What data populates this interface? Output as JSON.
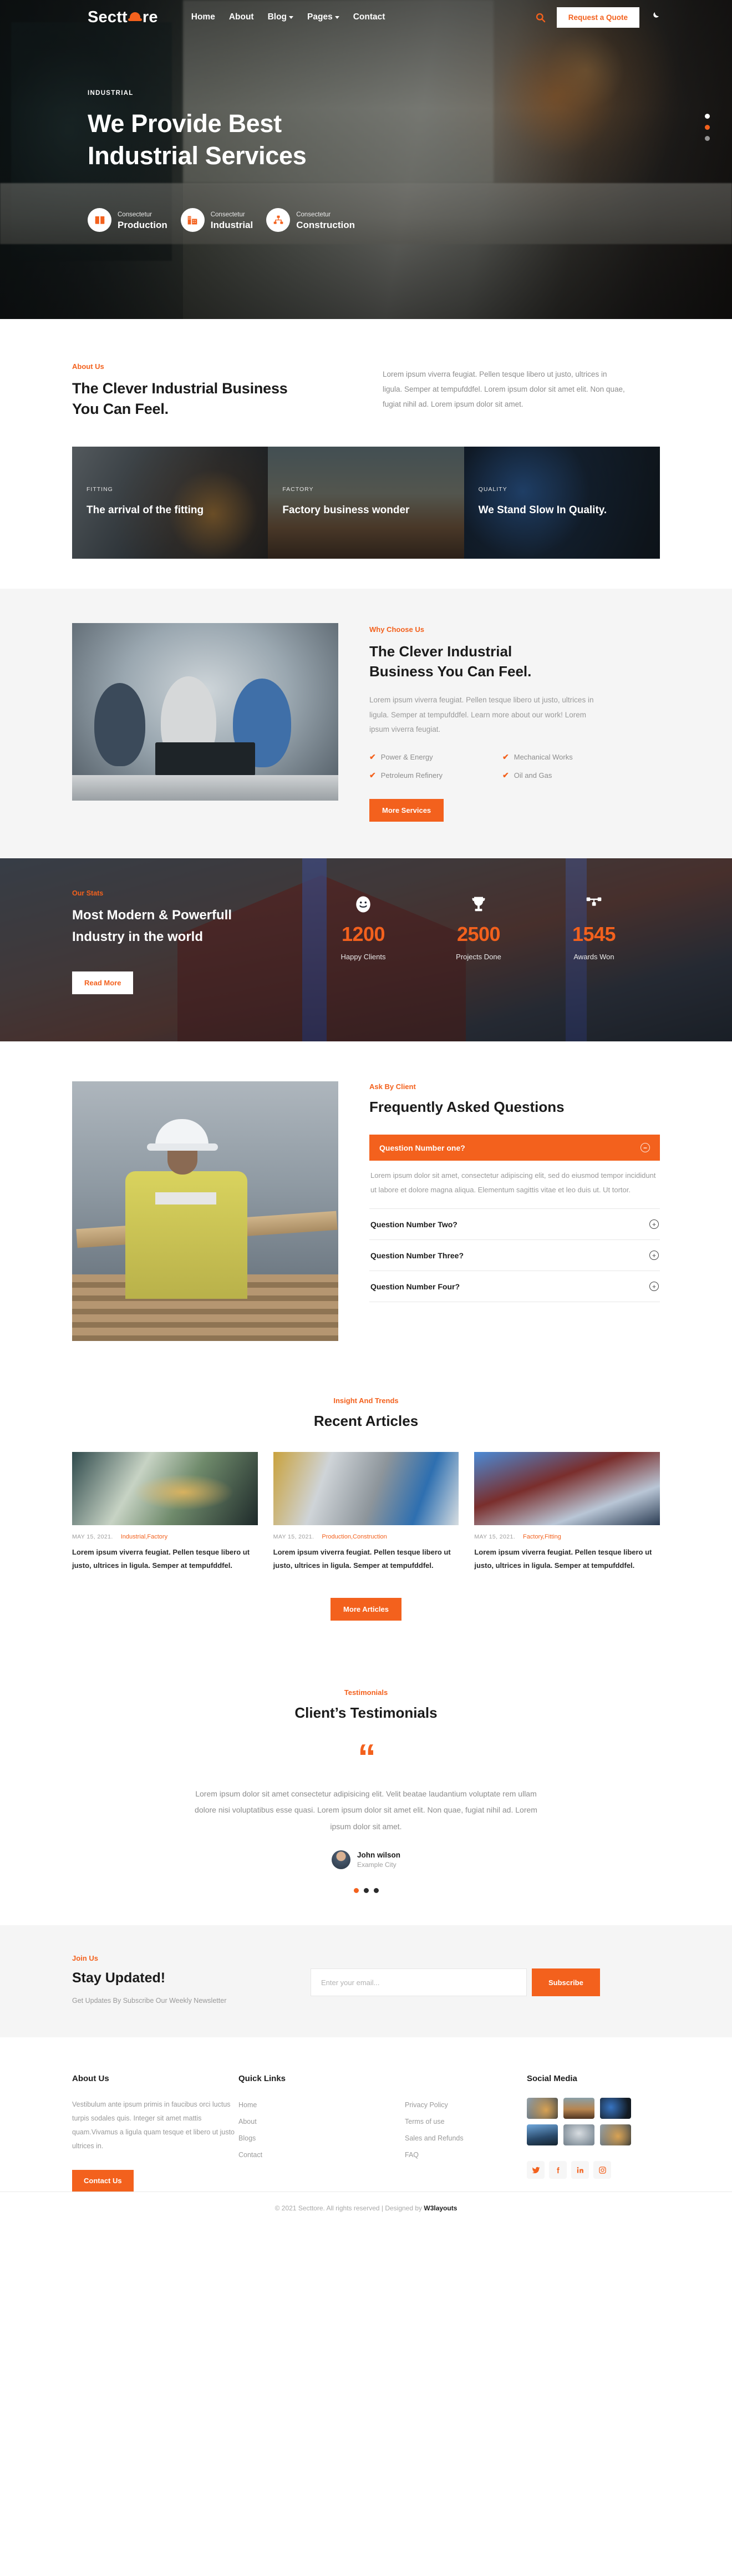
{
  "brand": {
    "name_part1": "Sectt",
    "name_part2": "re",
    "logo_icon": "hard-hat-icon"
  },
  "colors": {
    "accent": "#f3611d",
    "dark": "#1b1b1b",
    "muted": "#9a9a9a",
    "light_bg": "#f5f5f5"
  },
  "nav": {
    "items": [
      {
        "label": "Home",
        "caret": false
      },
      {
        "label": "About",
        "caret": false
      },
      {
        "label": "Blog",
        "caret": true
      },
      {
        "label": "Pages",
        "caret": true
      },
      {
        "label": "Contact",
        "caret": false
      }
    ],
    "search_icon": "search-icon",
    "quote_button": "Request a Quote",
    "theme_toggle_icon": "moon-icon"
  },
  "hero": {
    "kicker": "INDUSTRIAL",
    "title_line1": "We Provide Best",
    "title_line2": "Industrial Services",
    "cards": [
      {
        "sub": "Consectetur",
        "title": "Production",
        "icon": "box-icon"
      },
      {
        "sub": "Consectetur",
        "title": "Industrial",
        "icon": "factory-icon"
      },
      {
        "sub": "Consectetur",
        "title": "Construction",
        "icon": "sitemap-icon"
      }
    ],
    "slider_dots": [
      "active-white",
      "active-orange",
      "inactive"
    ]
  },
  "about": {
    "kicker": "About Us",
    "heading_line1": "The Clever Industrial Business",
    "heading_line2": "You Can Feel.",
    "paragraph": "Lorem ipsum viverra feugiat. Pellen tesque libero ut justo, ultrices in ligula. Semper at tempufddfel. Lorem ipsum dolor sit amet elit. Non quae, fugiat nihil ad. Lorem ipsum dolor sit amet.",
    "tiles": [
      {
        "kicker": "FITTING",
        "title": "The arrival of the fitting"
      },
      {
        "kicker": "FACTORY",
        "title": "Factory business wonder"
      },
      {
        "kicker": "QUALITY",
        "title": "We Stand Slow In Quality."
      }
    ]
  },
  "why": {
    "kicker": "Why Choose Us",
    "heading_line1": "The Clever Industrial",
    "heading_line2": "Business You Can Feel.",
    "paragraph": "Lorem ipsum viverra feugiat. Pellen tesque libero ut justo, ultrices in ligula. Semper at tempufddfel. Learn more about our work! Lorem ipsum viverra feugiat.",
    "features": [
      "Power & Energy",
      "Mechanical Works",
      "Petroleum Refinery",
      "Oil and Gas"
    ],
    "button": "More Services"
  },
  "stats": {
    "kicker": "Our Stats",
    "heading_line1": "Most Modern & Powerfull",
    "heading_line2": "Industry in the world",
    "button": "Read More",
    "counters": [
      {
        "icon": "smiley-icon",
        "value": "1200",
        "label": "Happy Clients"
      },
      {
        "icon": "trophy-icon",
        "value": "2500",
        "label": "Projects Done"
      },
      {
        "icon": "award-badge-icon",
        "value": "1545",
        "label": "Awards Won"
      }
    ]
  },
  "faq": {
    "kicker": "Ask By Client",
    "heading": "Frequently Asked Questions",
    "open_question": "Question Number one?",
    "open_answer": "Lorem ipsum dolor sit amet, consectetur adipiscing elit, sed do eiusmod tempor incididunt ut labore et dolore magna aliqua. Elementum sagittis vitae et leo duis ut. Ut tortor.",
    "collapsed": [
      "Question Number Two?",
      "Question Number Three?",
      "Question Number Four?"
    ],
    "minus_icon": "minus-circle-icon",
    "plus_icon": "plus-circle-icon"
  },
  "articles": {
    "kicker": "Insight And Trends",
    "heading": "Recent Articles",
    "items": [
      {
        "date": "MAY 15, 2021.",
        "tags": "Industrial,Factory",
        "text": "Lorem ipsum viverra feugiat. Pellen tesque libero ut justo, ultrices in ligula. Semper at tempufddfel."
      },
      {
        "date": "MAY 15, 2021.",
        "tags": "Production,Construction",
        "text": "Lorem ipsum viverra feugiat. Pellen tesque libero ut justo, ultrices in ligula. Semper at tempufddfel."
      },
      {
        "date": "MAY 15, 2021.",
        "tags": "Factory,Fitting",
        "text": "Lorem ipsum viverra feugiat. Pellen tesque libero ut justo, ultrices in ligula. Semper at tempufddfel."
      }
    ],
    "button": "More Articles"
  },
  "testimonials": {
    "kicker": "Testimonials",
    "heading": "Client’s Testimonials",
    "quote_icon": "quote-mark-icon",
    "quote": "Lorem ipsum dolor sit amet consectetur adipisicing elit. Velit beatae laudantium voluptate rem ullam dolore nisi voluptatibus esse quasi. Lorem ipsum dolor sit amet elit. Non quae, fugiat nihil ad. Lorem ipsum dolor sit amet.",
    "author_name": "John wilson",
    "author_city": "Example City",
    "dots": [
      "active",
      "inactive",
      "inactive"
    ]
  },
  "newsletter": {
    "kicker": "Join Us",
    "heading": "Stay Updated!",
    "subtext": "Get Updates By Subscribe Our Weekly Newsletter",
    "input_placeholder": "Enter your email...",
    "input_value": "",
    "button": "Subscribe"
  },
  "footer": {
    "about_heading": "About Us",
    "about_text": "Vestibulum ante ipsum primis in faucibus orci luctus turpis sodales quis. Integer sit amet mattis quam.Vivamus a ligula quam tesque et libero ut justo ultrices in.",
    "contact_button": "Contact Us",
    "links_heading": "Quick Links",
    "links_col1": [
      "Home",
      "About",
      "Blogs",
      "Contact"
    ],
    "links_col2": [
      "Privacy Policy",
      "Terms of use",
      "Sales and Refunds",
      "FAQ"
    ],
    "social_heading": "Social Media",
    "social_icons": [
      "twitter-icon",
      "facebook-icon",
      "linkedin-icon",
      "instagram-icon"
    ],
    "copyright_text": "© 2021 Secttore. All rights reserved | Designed by ",
    "copyright_brand": "W3layouts"
  }
}
